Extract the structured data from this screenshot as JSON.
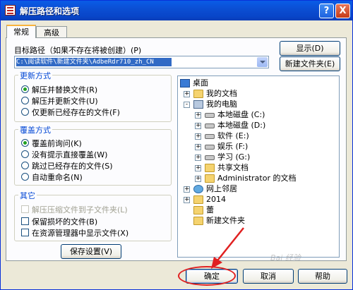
{
  "window": {
    "title": "解压路径和选项",
    "help_btn": "?",
    "close_btn": "X"
  },
  "tabs": [
    {
      "label": "常规"
    },
    {
      "label": "高级"
    }
  ],
  "dest": {
    "label": "目标路径（如果不存在将被创建）(P)",
    "value": "C:\\阅读软件\\新建文件夹\\AdbeRdr710_zh_CN",
    "show_button": "显示(D)",
    "new_folder_button": "新建文件夹(E)"
  },
  "update_mode": {
    "title": "更新方式",
    "options": [
      "解压并替换文件(R)",
      "解压并更新文件(U)",
      "仅更新已经存在的文件(F)"
    ],
    "selected": 0
  },
  "overwrite_mode": {
    "title": "覆盖方式",
    "options": [
      "覆盖前询问(K)",
      "没有提示直接覆盖(W)",
      "跳过已经存在的文件(S)",
      "自动重命名(N)"
    ],
    "selected": 0
  },
  "misc": {
    "title": "其它",
    "options": [
      {
        "label": "解压压缩文件到子文件夹(L)",
        "disabled": true
      },
      {
        "label": "保留损坏的文件(B)",
        "disabled": false
      },
      {
        "label": "在资源管理器中显示文件(X)",
        "disabled": false
      }
    ],
    "save_button": "保存设置(V)"
  },
  "tree": [
    {
      "label": "桌面",
      "icon": "desktop-icon",
      "level": 0,
      "exp": ""
    },
    {
      "label": "我的文档",
      "icon": "folder-icon",
      "level": 1,
      "exp": "+"
    },
    {
      "label": "我的电脑",
      "icon": "computer-icon",
      "level": 1,
      "exp": "-"
    },
    {
      "label": "本地磁盘 (C:)",
      "icon": "drive-icon",
      "level": 2,
      "exp": "+"
    },
    {
      "label": "本地磁盘 (D:)",
      "icon": "drive-icon",
      "level": 2,
      "exp": "+"
    },
    {
      "label": "软件 (E:)",
      "icon": "drive-icon",
      "level": 2,
      "exp": "+"
    },
    {
      "label": "娱乐 (F:)",
      "icon": "drive-icon",
      "level": 2,
      "exp": "+"
    },
    {
      "label": "学习 (G:)",
      "icon": "drive-icon",
      "level": 2,
      "exp": "+"
    },
    {
      "label": "共享文档",
      "icon": "folder-icon",
      "level": 2,
      "exp": "+"
    },
    {
      "label": "Administrator 的文档",
      "icon": "folder-icon",
      "level": 2,
      "exp": "+"
    },
    {
      "label": "网上邻居",
      "icon": "network-icon",
      "level": 1,
      "exp": "+"
    },
    {
      "label": "2014",
      "icon": "folder-icon",
      "level": 1,
      "exp": "+"
    },
    {
      "label": "蕾",
      "icon": "folder-icon",
      "level": 1,
      "exp": ""
    },
    {
      "label": "新建文件夹",
      "icon": "folder-icon",
      "level": 1,
      "exp": ""
    }
  ],
  "footer": {
    "ok": "确定",
    "cancel": "取消",
    "help": "帮助"
  },
  "watermark": "Bai 经验"
}
